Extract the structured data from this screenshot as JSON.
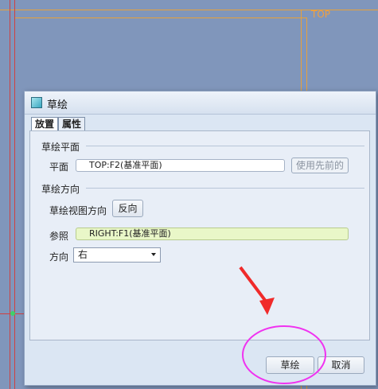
{
  "canvas": {
    "plane_label": "TOP"
  },
  "dialog": {
    "title": "草绘",
    "tabs": [
      {
        "label": "放置"
      },
      {
        "label": "属性"
      }
    ],
    "sketch_plane": {
      "section_title": "草绘平面",
      "plane_label": "平面",
      "plane_value": "TOP:F2(基准平面)",
      "use_previous_button": "使用先前的"
    },
    "sketch_orientation": {
      "section_title": "草绘方向",
      "view_direction_label": "草绘视图方向",
      "flip_button": "反向",
      "reference_label": "参照",
      "reference_value": "RIGHT:F1(基准平面)",
      "direction_label": "方向",
      "direction_value": "右"
    },
    "buttons": {
      "sketch": "草绘",
      "cancel": "取消"
    }
  },
  "colors": {
    "annotation": "#f032f0",
    "arrow": "#f02a2a"
  }
}
